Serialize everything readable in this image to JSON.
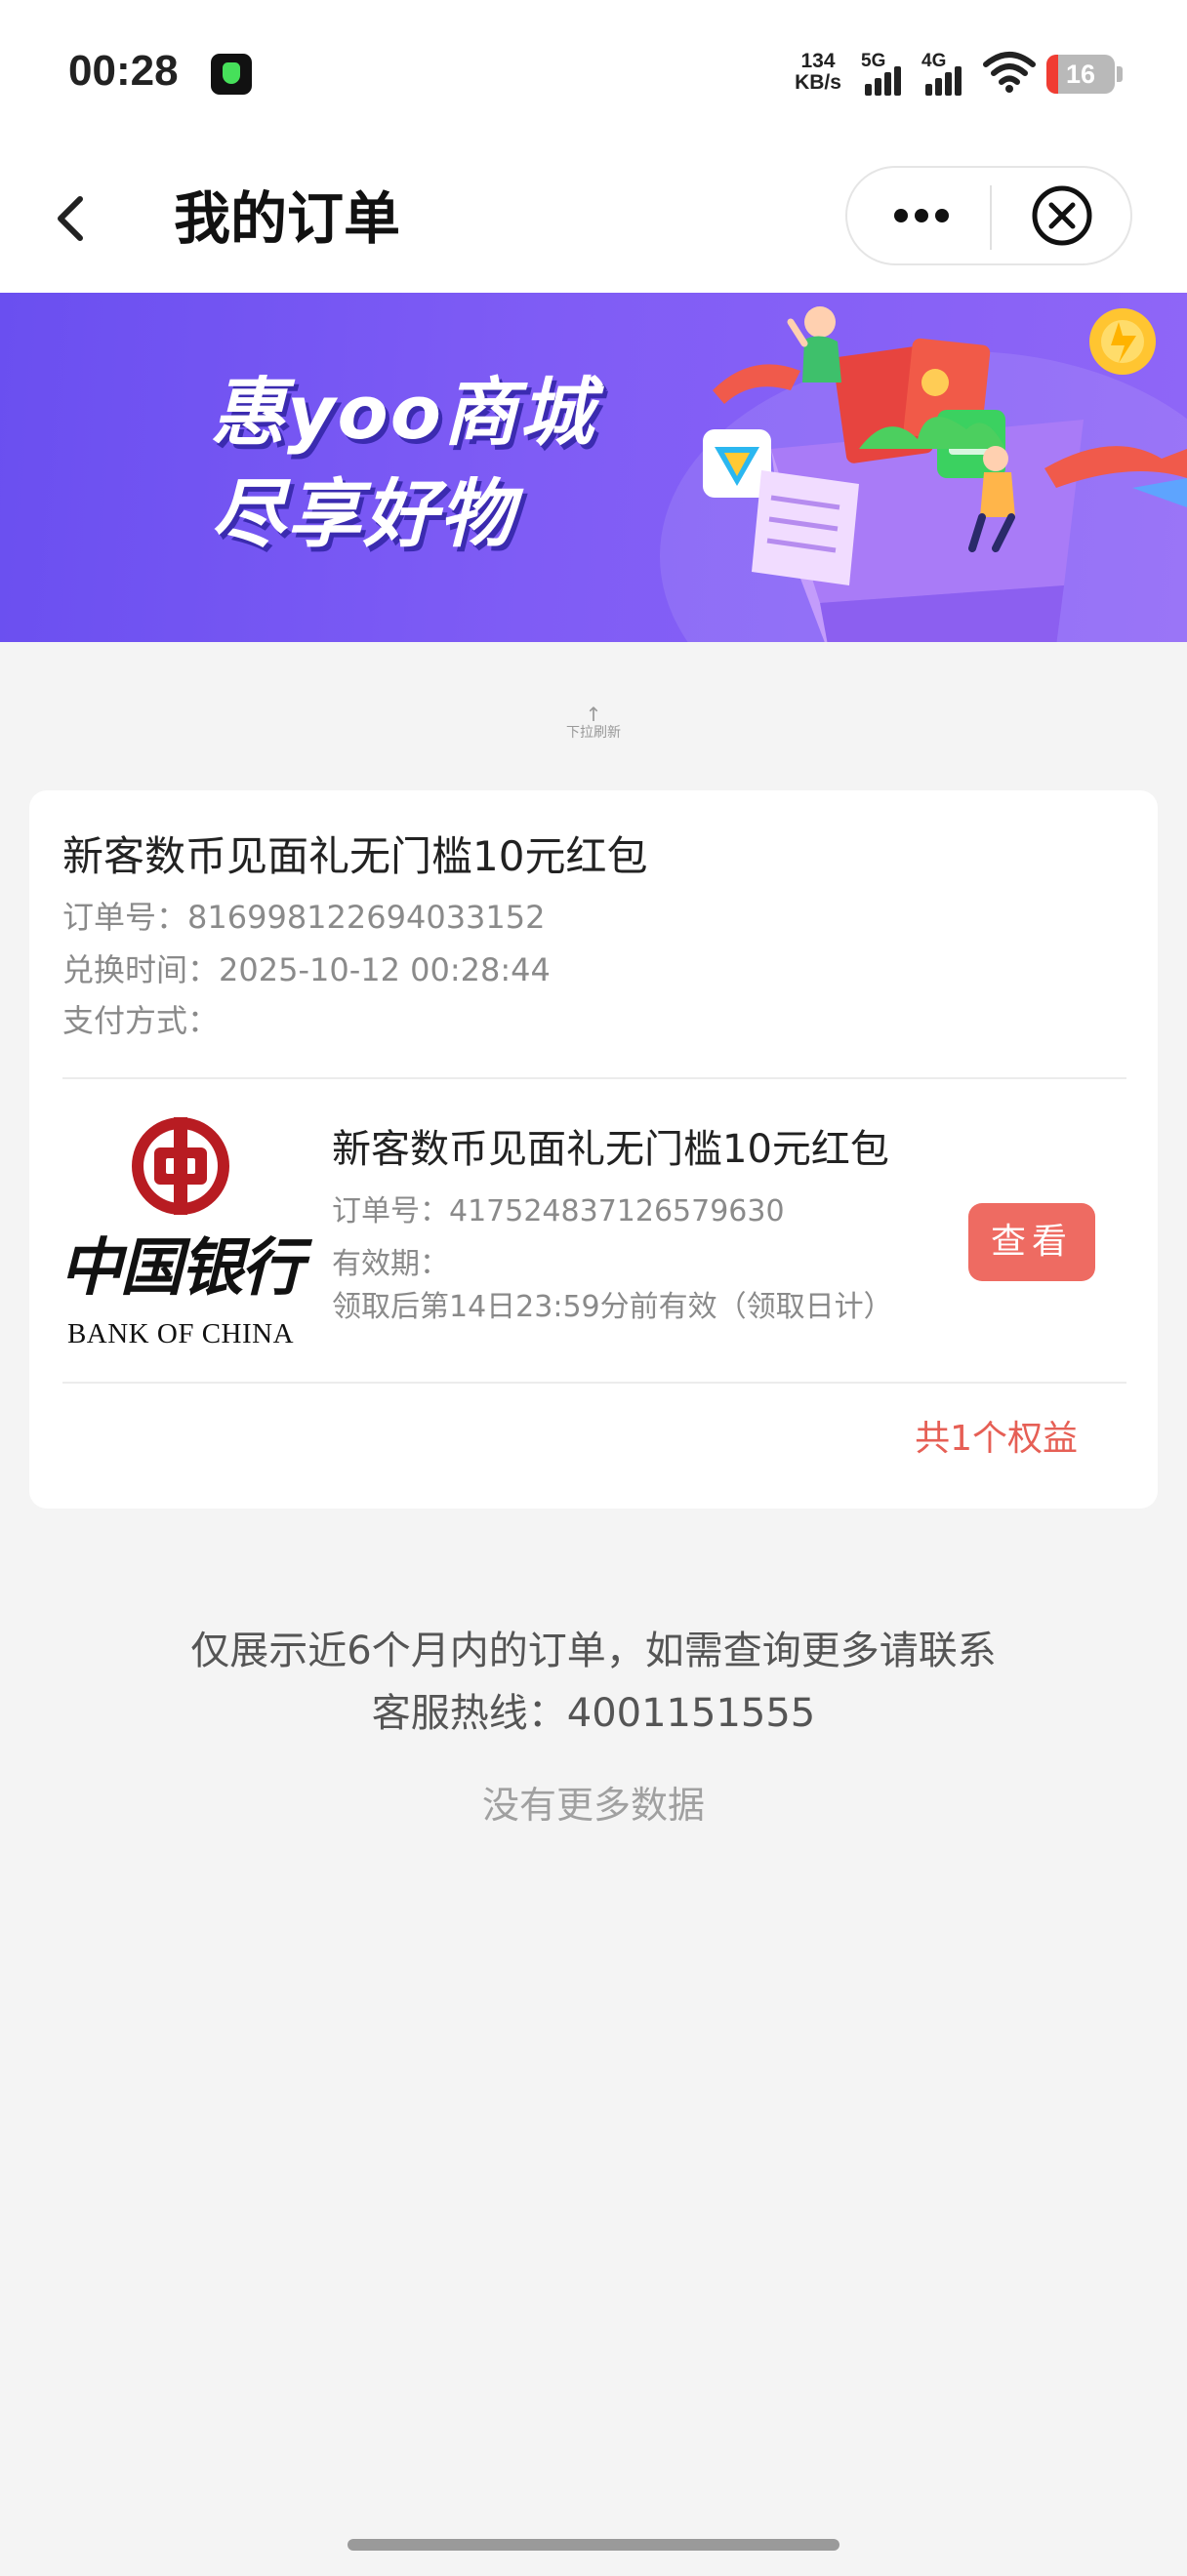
{
  "status_bar": {
    "time": "00:28",
    "net_speed_value": "134",
    "net_speed_unit": "KB/s",
    "signal_1_label": "5G",
    "signal_2_label": "4G",
    "battery_level": "16",
    "icons": [
      "music-app-icon",
      "signal-icon",
      "wifi-icon",
      "battery-icon"
    ]
  },
  "nav": {
    "title": "我的订单",
    "icons": [
      "back-icon",
      "more-icon",
      "close-icon"
    ]
  },
  "banner": {
    "line1": "惠yoo商城",
    "line2": "尽享好物"
  },
  "pull_refresh": {
    "label": "下拉刷新"
  },
  "order": {
    "title": "新客数币见面礼无门槛10元红包",
    "order_no_label": "订单号：",
    "order_no": "816998122694033152",
    "exchange_time_label": "兑换时间：",
    "exchange_time": "2025-10-12 00:28:44",
    "payment_label": "支付方式：",
    "payment_value": "",
    "item": {
      "bank_name_cn": "中国银行",
      "bank_name_en": "BANK OF CHINA",
      "title": "新客数币见面礼无门槛10元红包",
      "order_no_label": "订单号：",
      "order_no": "417524837126579630",
      "validity_label": "有效期：",
      "validity": "领取后第14日23:59分前有效（领取日计）",
      "view_button": "查看"
    },
    "benefit_count": "共1个权益"
  },
  "footer": {
    "notice_line1": "仅展示近6个月内的订单，如需查询更多请联系",
    "notice_line2_label": "客服热线：",
    "hotline": "4001151555",
    "no_more": "没有更多数据"
  },
  "colors": {
    "accent": "#ee6b62",
    "benefit_text": "#e65f55",
    "banner": "#7356f3",
    "bank_red": "#b81c22"
  }
}
